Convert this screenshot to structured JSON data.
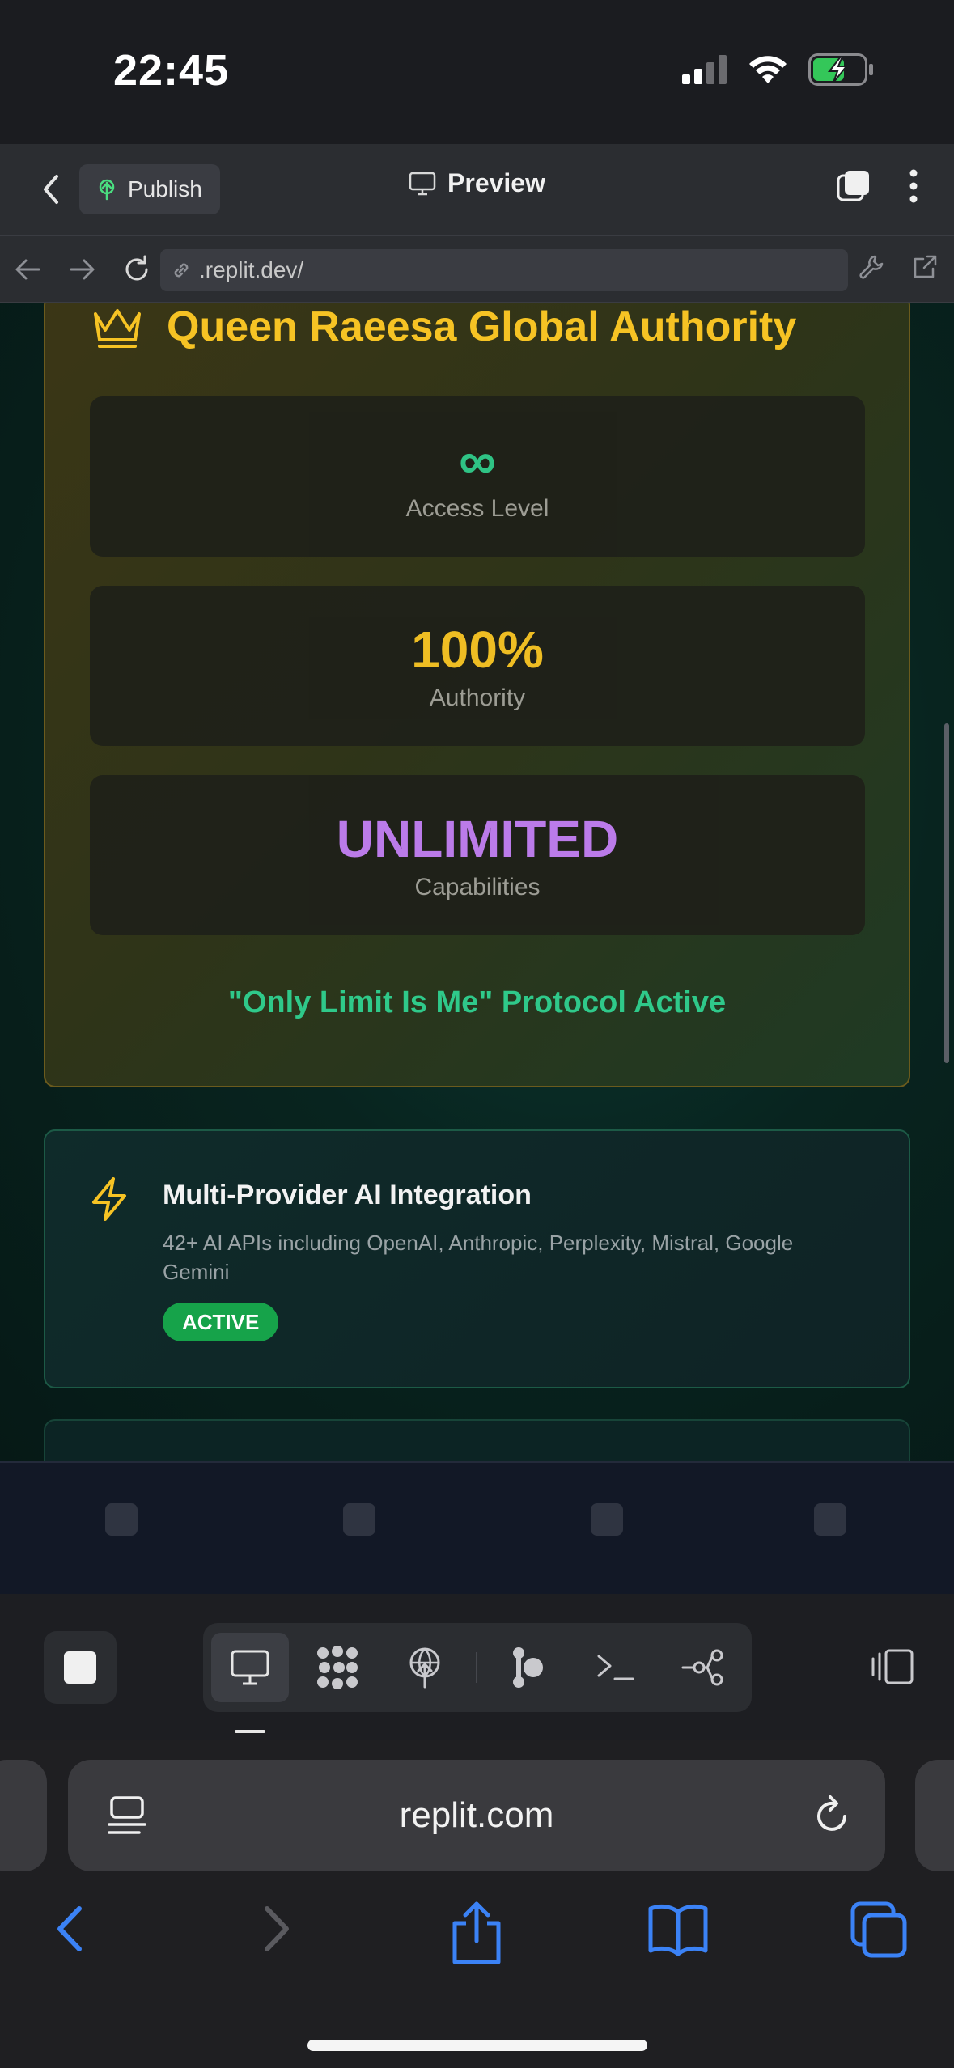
{
  "status_bar": {
    "time": "22:45",
    "icons": [
      "cellular-signal-icon",
      "wifi-icon",
      "battery-charging-icon"
    ]
  },
  "header": {
    "publish_label": "Publish",
    "title": "Preview",
    "icons": [
      "back-chevron-icon",
      "publish-icon",
      "monitor-icon",
      "tabs-icon",
      "more-vertical-icon"
    ]
  },
  "browser_bar": {
    "url": ".replit.dev/",
    "icons": [
      "arrow-left-icon",
      "arrow-right-icon",
      "reload-icon",
      "link-icon",
      "wrench-icon",
      "external-link-icon"
    ]
  },
  "authority_card": {
    "title": "Queen Raeesa Global Authority",
    "icon": "crown-icon",
    "accent_color": "#f6c324",
    "stats": [
      {
        "value": "∞",
        "label": "Access Level",
        "color": "#2fc98a"
      },
      {
        "value": "100%",
        "label": "Authority",
        "color": "#f6c324"
      },
      {
        "value": "UNLIMITED",
        "label": "Capabilities",
        "color": "#c17ef2"
      }
    ],
    "protocol_text": "\"Only Limit Is Me\" Protocol Active"
  },
  "features": [
    {
      "icon": "lightning-icon",
      "title": "Multi-Provider AI Integration",
      "description": "42+ AI APIs including OpenAI, Anthropic, Perplexity, Mistral, Google Gemini",
      "status": "ACTIVE",
      "status_color": "#16a34a"
    }
  ],
  "toolbar": {
    "tools": [
      "monitor-icon",
      "apps-icon",
      "deploy-icon",
      "agent-icon",
      "terminal-icon",
      "git-icon"
    ],
    "active_tool": "monitor-icon",
    "icons": [
      "stop-icon",
      "split-view-icon"
    ]
  },
  "safari": {
    "address": "replit.com",
    "icons": [
      "page-menu-icon",
      "reload-icon",
      "back-icon",
      "forward-icon",
      "share-icon",
      "bookmarks-icon",
      "tabs-icon"
    ],
    "accent_color": "#3b82f6"
  }
}
